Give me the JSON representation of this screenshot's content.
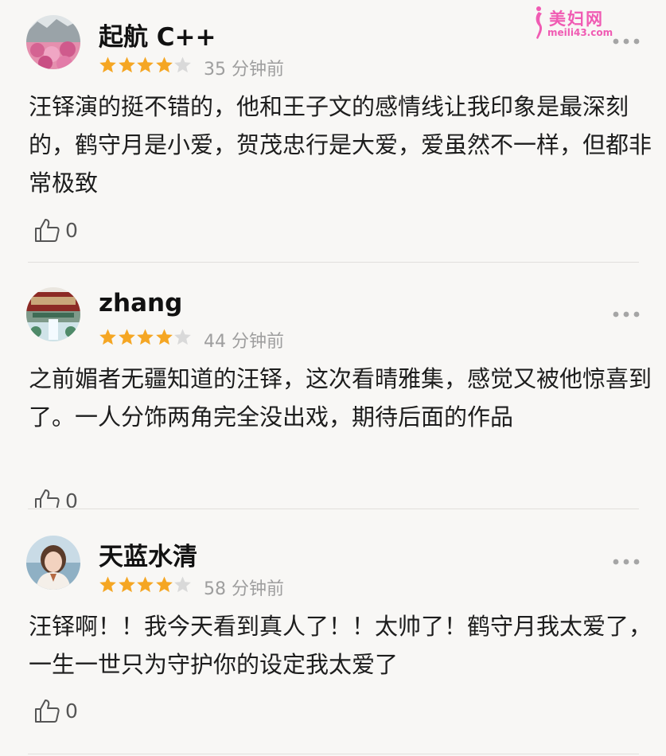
{
  "watermark": {
    "title": "美妇网",
    "url": "meili43.com"
  },
  "comments": [
    {
      "username": "起航 C++",
      "rating": 4,
      "time": "35 分钟前",
      "text": "汪铎演的挺不错的，他和王子文的感情线让我印象是最深刻的，鹤守月是小爱，贺茂忠行是大爱，爱虽然不一样，但都非常极致",
      "likes": "0"
    },
    {
      "username": "zhang",
      "rating": 4,
      "time": "44 分钟前",
      "text": "之前媚者无疆知道的汪铎，这次看晴雅集，感觉又被他惊喜到了。一人分饰两角完全没出戏，期待后面的作品",
      "likes": "0"
    },
    {
      "username": "天蓝水清",
      "rating": 4,
      "time": "58 分钟前",
      "text": "汪铎啊！！我今天看到真人了！！太帅了！鹤守月我太爱了，一生一世只为守护你的设定我太爱了",
      "likes": "0"
    }
  ],
  "colors": {
    "star_filled": "#f5a623",
    "star_empty": "#d9d9d9",
    "watermark": "#f05bb3"
  },
  "icons": {
    "star": "star-icon",
    "like": "thumbs-up-icon",
    "more": "more-dots-icon"
  }
}
